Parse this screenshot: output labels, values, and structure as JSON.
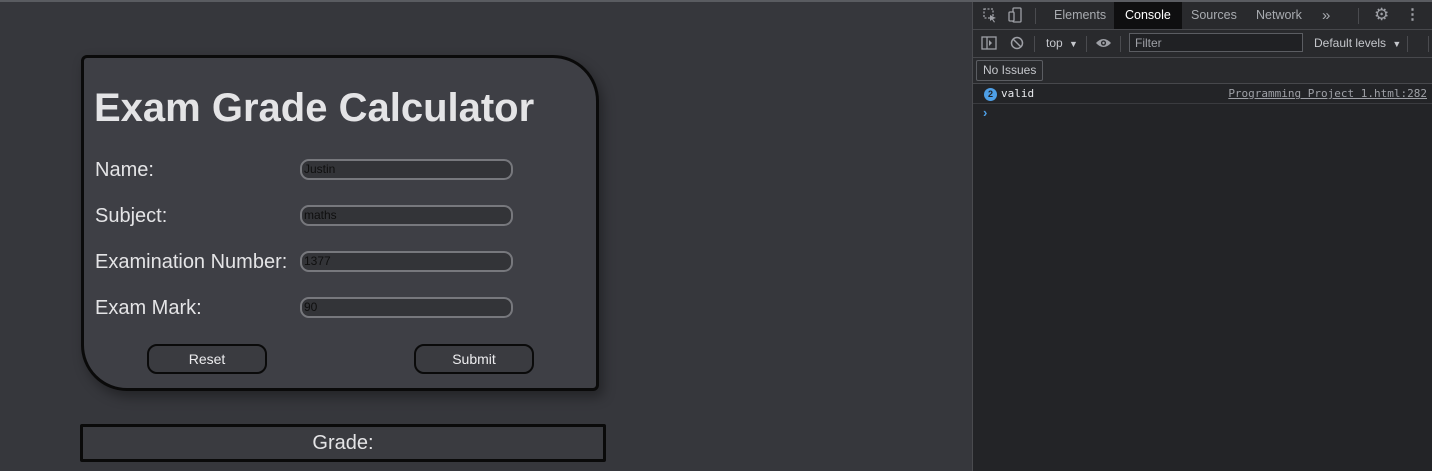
{
  "form": {
    "title": "Exam Grade Calculator",
    "fields": [
      {
        "label": "Name:",
        "value": "Justin"
      },
      {
        "label": "Subject:",
        "value": "maths"
      },
      {
        "label": "Examination Number:",
        "value": "1377"
      },
      {
        "label": "Exam Mark:",
        "value": "90"
      }
    ],
    "reset_label": "Reset",
    "submit_label": "Submit"
  },
  "grade": {
    "label": "Grade:"
  },
  "devtools": {
    "tabs": [
      "Elements",
      "Console",
      "Sources",
      "Network"
    ],
    "active_tab": "Console",
    "more_tabs_icon": "»",
    "context": "top",
    "filter_placeholder": "Filter",
    "levels": "Default levels",
    "issues": "No Issues",
    "message": {
      "count": "2",
      "text": "valid",
      "source": "Programming Project 1.html:282"
    },
    "prompt": "›"
  },
  "colors": {
    "page_bg": "#36373c",
    "card_bg": "#3e3f45",
    "devtools_bg": "#232427",
    "accent": "#4e9fe6"
  }
}
